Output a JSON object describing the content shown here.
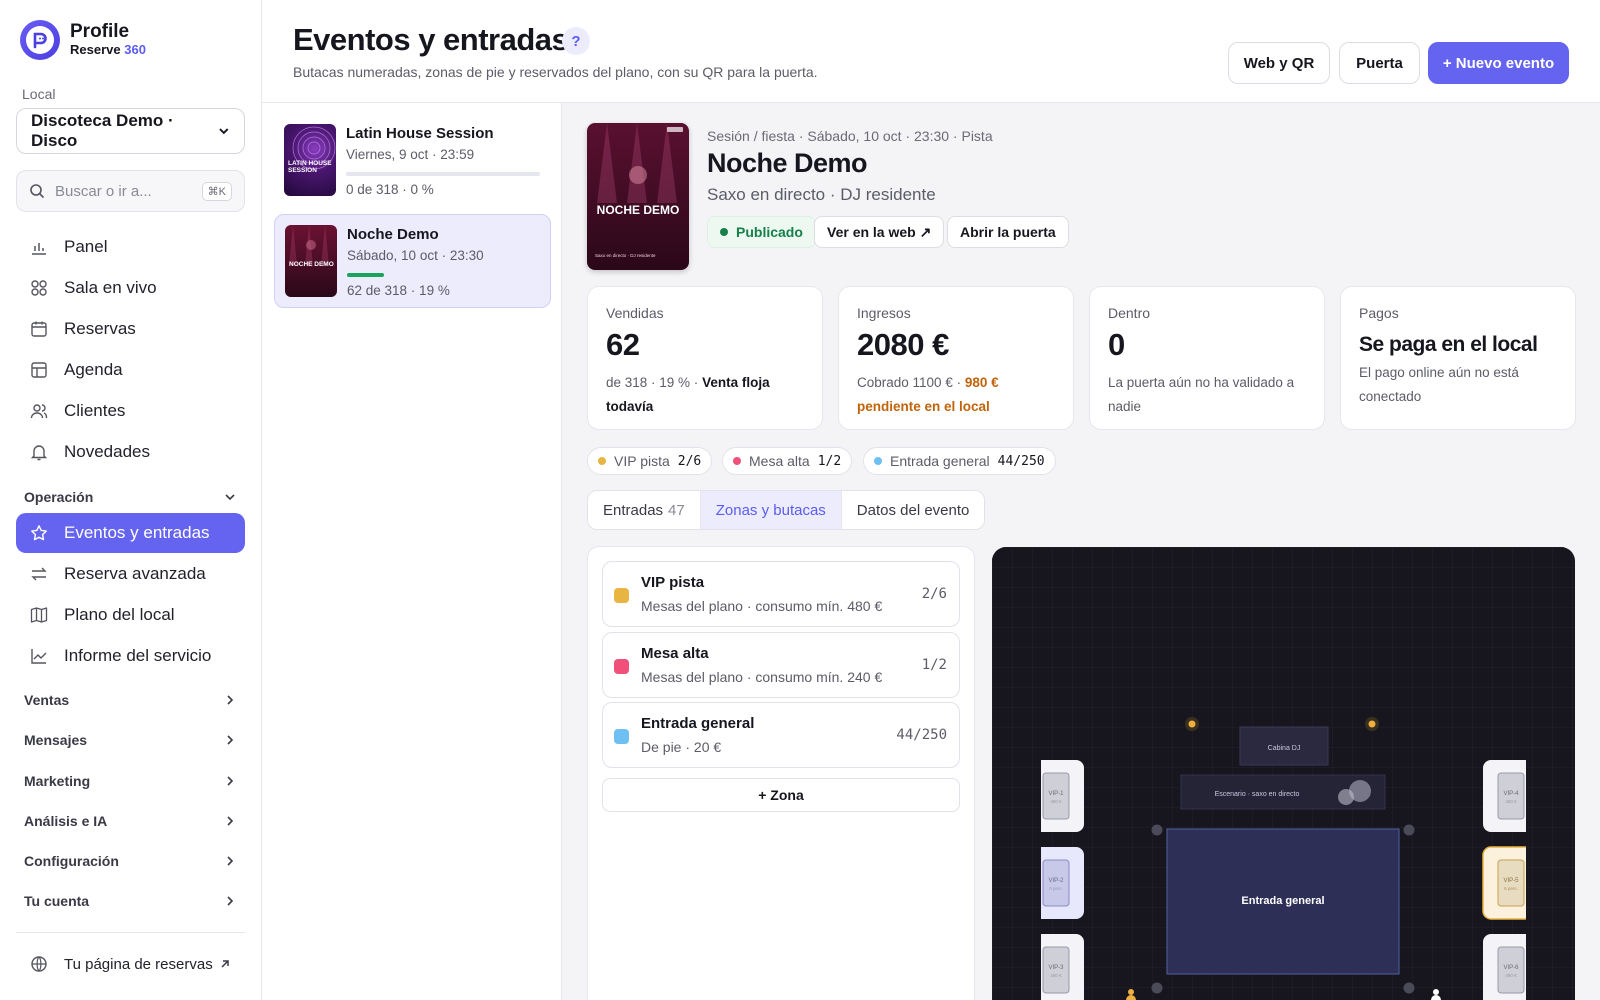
{
  "brand": {
    "name": "Profile",
    "sub": "Reserve",
    "sub_accent": "360"
  },
  "sidebar": {
    "local_label": "Local",
    "venue": "Discoteca Demo · Disco",
    "search_placeholder": "Buscar o ir a...",
    "search_shortcut": "⌘K",
    "items": [
      {
        "label": "Panel",
        "icon": "chart-icon"
      },
      {
        "label": "Sala en vivo",
        "icon": "grid-icon"
      },
      {
        "label": "Reservas",
        "icon": "calendar-icon"
      },
      {
        "label": "Agenda",
        "icon": "table-icon"
      },
      {
        "label": "Clientes",
        "icon": "users-icon"
      },
      {
        "label": "Novedades",
        "icon": "bell-icon"
      }
    ],
    "operation_label": "Operación",
    "operation_items": [
      {
        "label": "Eventos y entradas",
        "icon": "star-icon",
        "active": true
      },
      {
        "label": "Reserva avanzada",
        "icon": "swap-icon"
      },
      {
        "label": "Plano del local",
        "icon": "map-icon"
      },
      {
        "label": "Informe del servicio",
        "icon": "trend-icon"
      }
    ],
    "sections": [
      "Ventas",
      "Mensajes",
      "Marketing",
      "Análisis e IA",
      "Configuración",
      "Tu cuenta"
    ],
    "booking_page": "Tu página de reservas"
  },
  "header": {
    "title": "Eventos y entradas",
    "help": "?",
    "subtitle": "Butacas numeradas, zonas de pie y reservados del plano, con su QR para la puerta.",
    "btn_web": "Web y QR",
    "btn_door": "Puerta",
    "btn_new": "+ Nuevo evento"
  },
  "events": [
    {
      "name": "Latin House Session",
      "date": "Viernes, 9 oct · 23:59",
      "stat": "0 de 318 · 0 %",
      "progress": 0,
      "thumb_text": "LATIN HOUSE SESSION"
    },
    {
      "name": "Noche Demo",
      "date": "Sábado, 10 oct · 23:30",
      "stat": "62 de 318 · 19 %",
      "progress": 0.19,
      "thumb_text": "NOCHE DEMO"
    }
  ],
  "detail": {
    "poster_title": "NOCHE DEMO",
    "poster_sub": "Saxo en directo · DJ residente",
    "meta": "Sesión / fiesta · Sábado, 10 oct · 23:30 · Pista",
    "title": "Noche Demo",
    "subtitle": "Saxo en directo · DJ residente",
    "status": "Publicado",
    "btn_web": "Ver en la web ↗",
    "btn_door": "Abrir la puerta"
  },
  "stats": {
    "sold": {
      "label": "Vendidas",
      "value": "62",
      "note": "de 318 · 19 % ·",
      "note_bold": "Venta floja todavía"
    },
    "revenue": {
      "label": "Ingresos",
      "value": "2080 €",
      "note": "Cobrado 1100 € ·",
      "note_warn": "980 € pendiente en el local"
    },
    "inside": {
      "label": "Dentro",
      "value": "0",
      "note": "La puerta aún no ha validado a nadie"
    },
    "payments": {
      "label": "Pagos",
      "value": "Se paga en el local",
      "note": "El pago online aún no está conectado"
    }
  },
  "chips": [
    {
      "label": "VIP pista",
      "count": "2/6",
      "color": "#e8b442"
    },
    {
      "label": "Mesa alta",
      "count": "1/2",
      "color": "#f0507a"
    },
    {
      "label": "Entrada general",
      "count": "44/250",
      "color": "#6ec0f2"
    }
  ],
  "tabs": [
    {
      "label": "Entradas",
      "count": "47"
    },
    {
      "label": "Zonas y butacas",
      "count": ""
    },
    {
      "label": "Datos del evento",
      "count": ""
    }
  ],
  "zones": [
    {
      "name": "VIP pista",
      "desc": "Mesas del plano · consumo mín. 480 €",
      "count": "2/6",
      "color": "#e8b442"
    },
    {
      "name": "Mesa alta",
      "desc": "Mesas del plano · consumo mín. 240 €",
      "count": "1/2",
      "color": "#f0507a"
    },
    {
      "name": "Entrada general",
      "desc": "De pie · 20 €",
      "count": "44/250",
      "color": "#6ec0f2"
    }
  ],
  "add_zone": "+ Zona",
  "map": {
    "dj_booth": "Cabina DJ",
    "stage": "Escenario · saxo en directo",
    "general_area": "Entrada general",
    "tables": [
      {
        "label": "VIP-1",
        "price": "480 €"
      },
      {
        "label": "VIP-2",
        "price": "0 pers."
      },
      {
        "label": "VIP-3",
        "price": "480 €"
      },
      {
        "label": "VIP-4",
        "price": "480 €"
      },
      {
        "label": "VIP-5",
        "price": "6 pers."
      },
      {
        "label": "VIP-6",
        "price": "480 €"
      }
    ]
  }
}
